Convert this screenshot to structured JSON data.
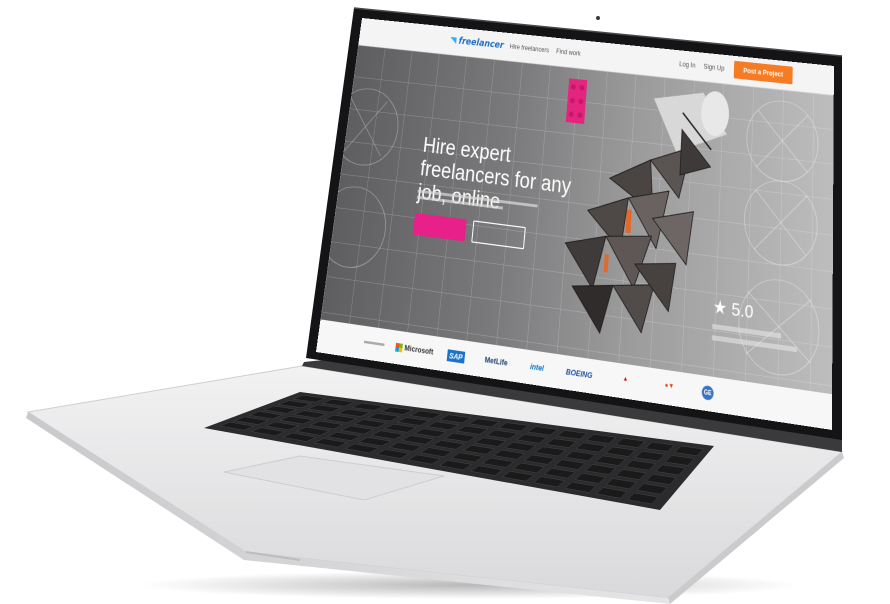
{
  "nav": {
    "logo": "freelancer",
    "links": [
      "Hire freelancers",
      "Find work"
    ],
    "login": "Log In",
    "signup": "Sign Up",
    "post_project": "Post a Project"
  },
  "hero": {
    "title": "Hire expert freelancers for any job, online",
    "rating": "★ 5.0"
  },
  "logos": {
    "microsoft": "Microsoft",
    "sap": "SAP",
    "metlife": "MetLife",
    "intel": "intel",
    "boeing": "BOEING",
    "ge": "GE"
  },
  "colors": {
    "nav_button": "#f57c25",
    "hire_button": "#e8208a",
    "brand": "#1f6ec2"
  }
}
